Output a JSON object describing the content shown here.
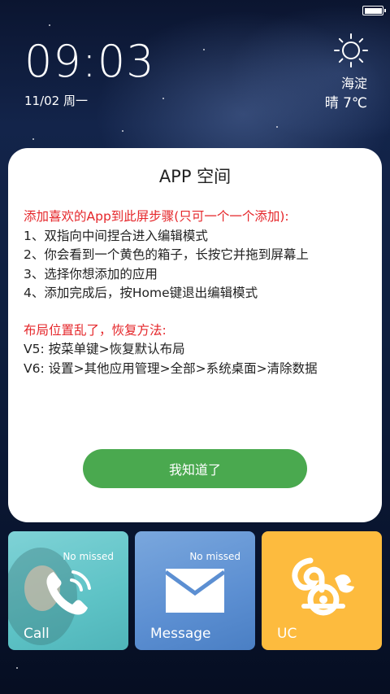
{
  "status": {
    "battery_level": 1.0
  },
  "lockscreen": {
    "time": "09:03",
    "date": "11/02 周一"
  },
  "weather": {
    "icon": "sun-icon",
    "city": "海淀",
    "condition_temp": "晴  7℃"
  },
  "dialog": {
    "title": "APP 空间",
    "section1_heading": "添加喜欢的App到此屏步骤(只可一个一个添加):",
    "steps": [
      "1、双指向中间捏合进入编辑模式",
      "2、你会看到一个黄色的箱子，长按它并拖到屏幕上",
      "3、选择你想添加的应用",
      "4、添加完成后，按Home键退出编辑模式"
    ],
    "section2_heading": "布局位置乱了，恢复方法:",
    "restore": [
      "V5: 按菜单键>恢复默认布局",
      "V6: 设置>其他应用管理>全部>系统桌面>清除数据"
    ],
    "ok_label": "我知道了"
  },
  "tiles": [
    {
      "label": "Call",
      "sub": "No missed",
      "icon": "phone-icon",
      "color": "#5ec3c6"
    },
    {
      "label": "Message",
      "sub": "No missed",
      "icon": "envelope-icon",
      "color": "#5c8fd2"
    },
    {
      "label": "UC",
      "icon": "uc-squirrel-icon",
      "color": "#fdbb3e"
    }
  ]
}
